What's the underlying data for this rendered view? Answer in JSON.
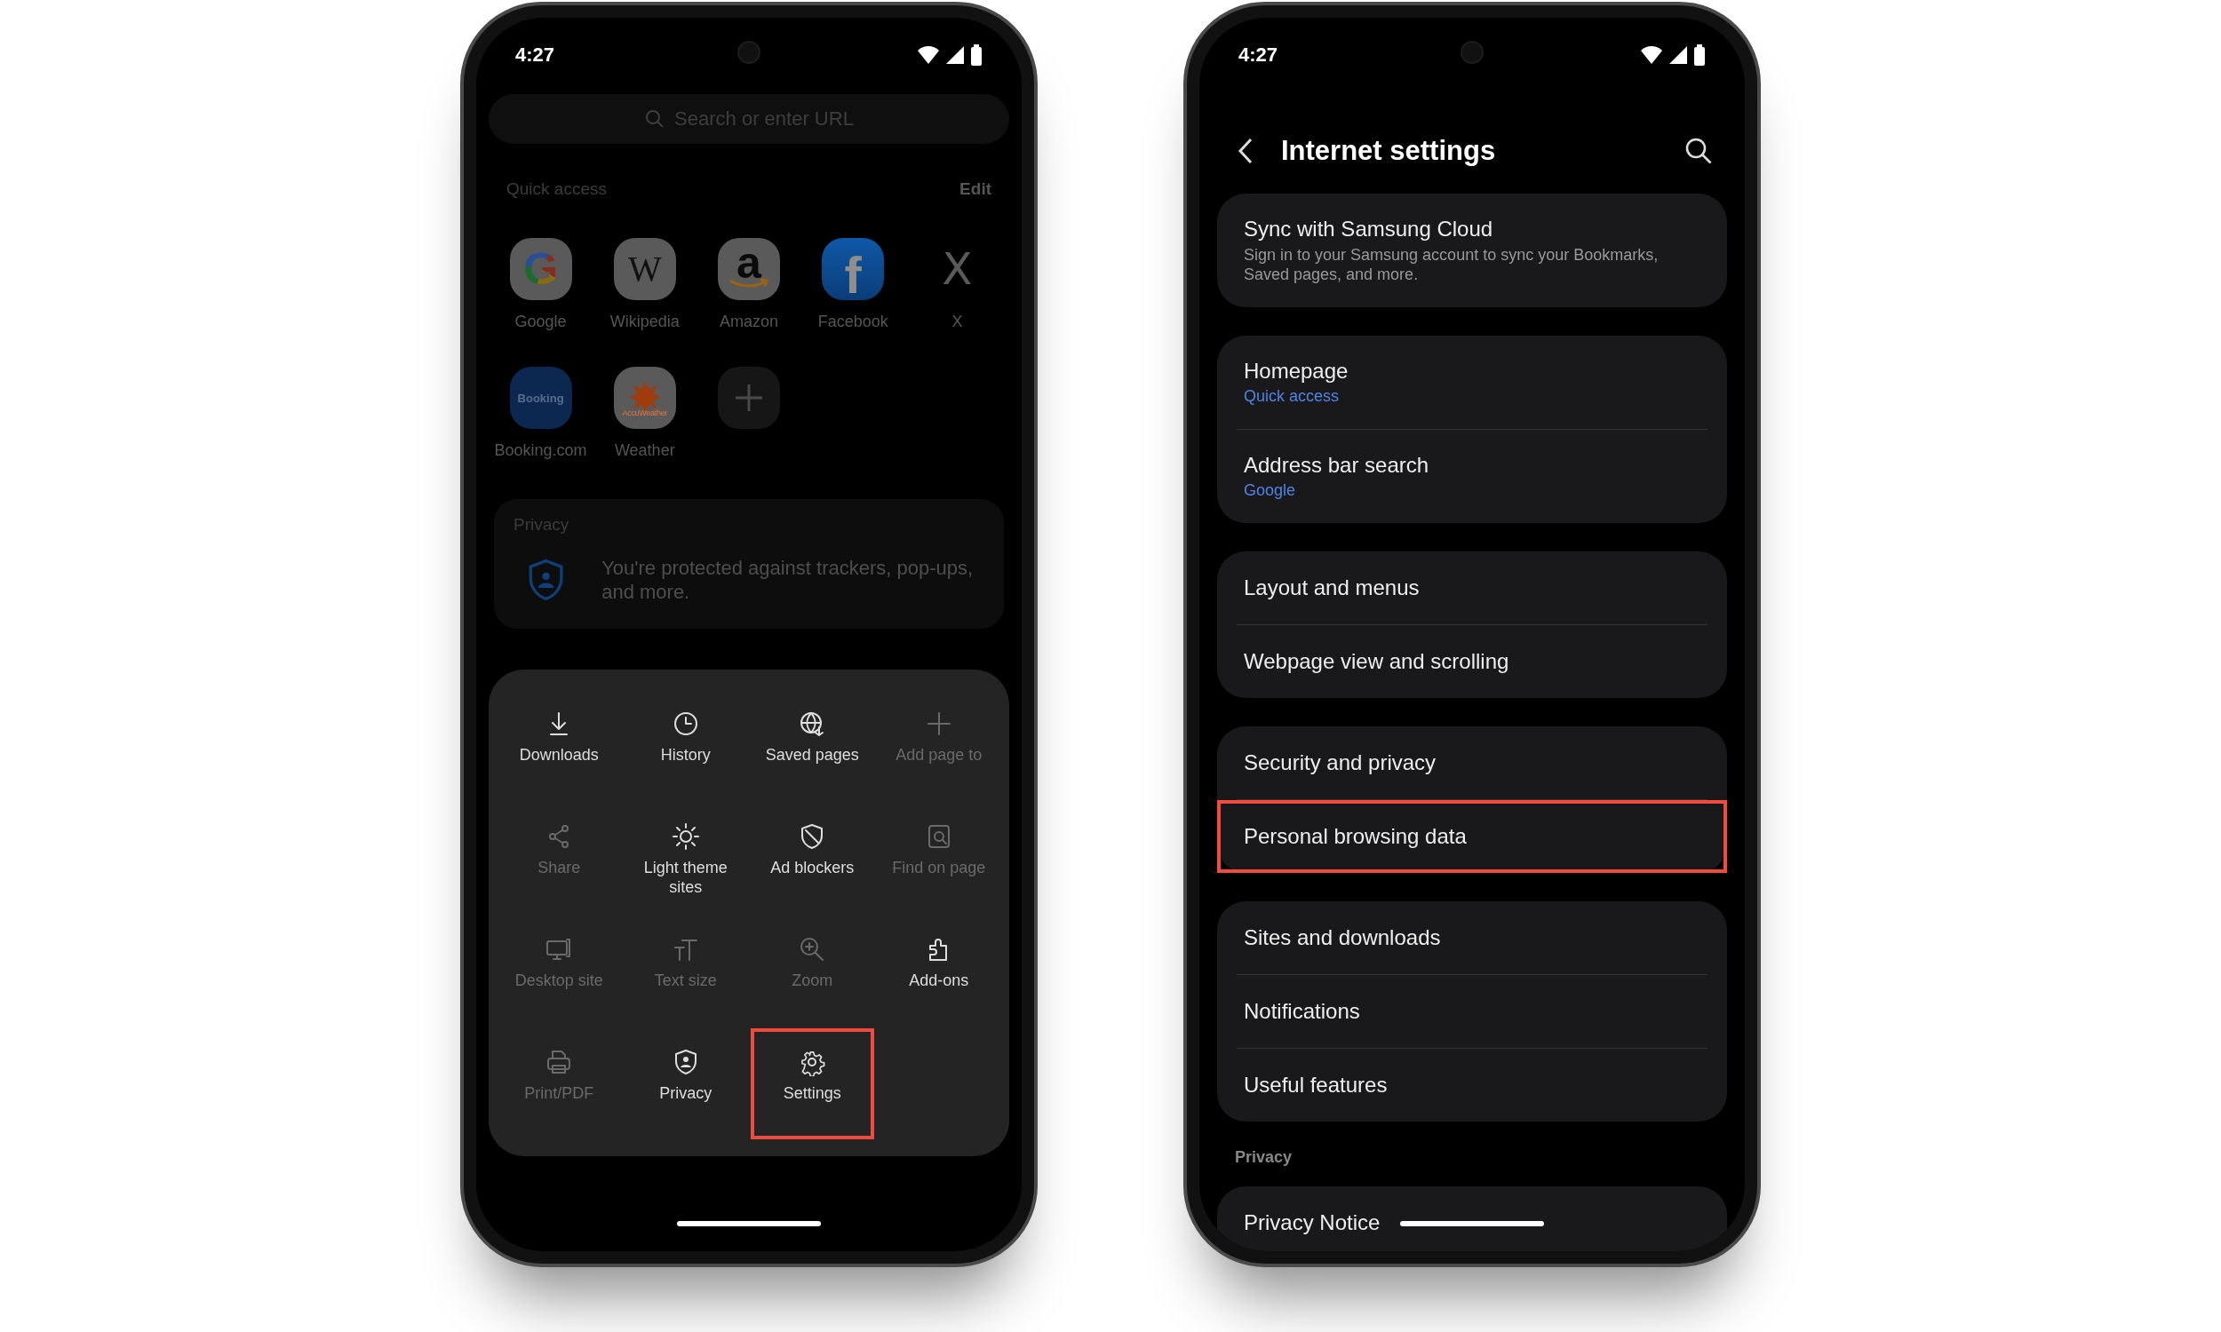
{
  "browser_screen": {
    "status_bar": {
      "time": "4:27"
    },
    "search": {
      "placeholder": "Search or enter URL"
    },
    "quick_access": {
      "title": "Quick access",
      "edit": "Edit",
      "shortcuts": [
        {
          "kind": "google",
          "label": "Google",
          "logo": "G"
        },
        {
          "kind": "wikipedia",
          "label": "Wikipedia",
          "logo": "W"
        },
        {
          "kind": "amazon",
          "label": "Amazon",
          "logo": "a"
        },
        {
          "kind": "facebook",
          "label": "Facebook",
          "logo": "f"
        },
        {
          "kind": "x",
          "label": "X",
          "logo": "X"
        },
        {
          "kind": "booking",
          "label": "Booking.com",
          "logo": "Booking"
        },
        {
          "kind": "weather",
          "label": "Weather",
          "logo": "AccuWeather"
        },
        {
          "kind": "add"
        }
      ]
    },
    "privacy_card": {
      "title": "Privacy",
      "text": "You're protected against trackers, pop-ups, and more."
    },
    "menu": {
      "items": [
        {
          "kind": "download",
          "label": "Downloads",
          "disabled": false,
          "highlighted": false
        },
        {
          "kind": "history",
          "label": "History",
          "disabled": false,
          "highlighted": false
        },
        {
          "kind": "saved",
          "label": "Saved pages",
          "disabled": false,
          "highlighted": false
        },
        {
          "kind": "add",
          "label": "Add page to",
          "disabled": true,
          "highlighted": false
        },
        {
          "kind": "share",
          "label": "Share",
          "disabled": true,
          "highlighted": false
        },
        {
          "kind": "theme",
          "label": "Light theme sites",
          "disabled": false,
          "highlighted": false
        },
        {
          "kind": "adblock",
          "label": "Ad blockers",
          "disabled": false,
          "highlighted": false
        },
        {
          "kind": "find",
          "label": "Find on page",
          "disabled": true,
          "highlighted": false
        },
        {
          "kind": "desktop",
          "label": "Desktop site",
          "disabled": true,
          "highlighted": false
        },
        {
          "kind": "textsize",
          "label": "Text size",
          "disabled": true,
          "highlighted": false
        },
        {
          "kind": "zoom",
          "label": "Zoom",
          "disabled": true,
          "highlighted": false
        },
        {
          "kind": "addons",
          "label": "Add-ons",
          "disabled": false,
          "highlighted": false
        },
        {
          "kind": "print",
          "label": "Print/PDF",
          "disabled": true,
          "highlighted": false
        },
        {
          "kind": "privacy",
          "label": "Privacy",
          "disabled": false,
          "highlighted": false
        },
        {
          "kind": "settings",
          "label": "Settings",
          "disabled": false,
          "highlighted": true
        }
      ]
    }
  },
  "settings_screen": {
    "status_bar": {
      "time": "4:27"
    },
    "title": "Internet settings",
    "groups": [
      {
        "items": [
          {
            "title": "Sync with Samsung Cloud",
            "description": "Sign in to your Samsung account to sync your Bookmarks, Saved pages, and more.",
            "highlighted": false
          }
        ]
      },
      {
        "items": [
          {
            "title": "Homepage",
            "value": "Quick access",
            "highlighted": false
          },
          {
            "title": "Address bar search",
            "value": "Google",
            "highlighted": false
          }
        ]
      },
      {
        "items": [
          {
            "title": "Layout and menus",
            "highlighted": false
          },
          {
            "title": "Webpage view and scrolling",
            "highlighted": false
          }
        ]
      },
      {
        "items": [
          {
            "title": "Security and privacy",
            "highlighted": false
          },
          {
            "title": "Personal browsing data",
            "highlighted": true
          }
        ]
      },
      {
        "items": [
          {
            "title": "Sites and downloads",
            "highlighted": false
          },
          {
            "title": "Notifications",
            "highlighted": false
          },
          {
            "title": "Useful features",
            "highlighted": false
          }
        ]
      },
      {
        "header": "Privacy",
        "items": [
          {
            "title": "Privacy Notice",
            "highlighted": false
          }
        ]
      }
    ]
  }
}
